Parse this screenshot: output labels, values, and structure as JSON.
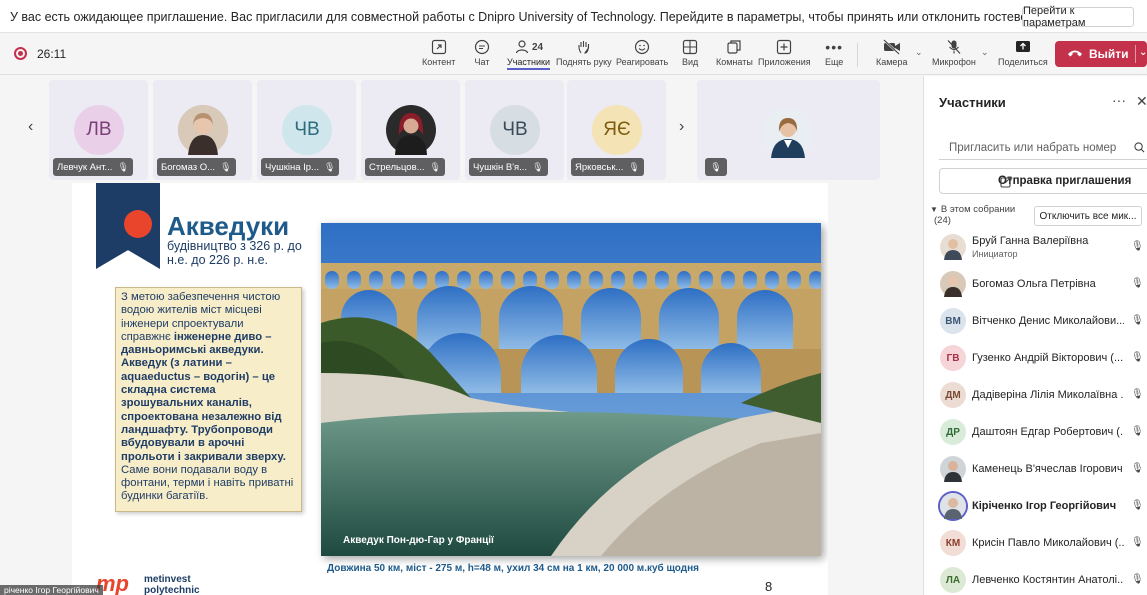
{
  "notification": {
    "text": "У вас есть ожидающее приглашение. Вас пригласили для совместной работы с Dnipro University of Technology. Перейдите в параметры, чтобы принять или отклонить гостевое приглашение.",
    "button": "Перейти к параметрам"
  },
  "toolbar": {
    "timer": "26:11",
    "items": [
      {
        "label": "Контент",
        "icon": "share-content-icon"
      },
      {
        "label": "Чат",
        "icon": "chat-icon"
      },
      {
        "label": "Участники",
        "icon": "people-icon",
        "count": "24"
      },
      {
        "label": "Поднять руку",
        "icon": "raise-hand-icon"
      },
      {
        "label": "Реагировать",
        "icon": "react-icon"
      },
      {
        "label": "Вид",
        "icon": "view-grid-icon"
      },
      {
        "label": "Комнаты",
        "icon": "breakout-rooms-icon"
      },
      {
        "label": "Приложения",
        "icon": "apps-icon"
      },
      {
        "label": "Еще",
        "icon": "more-icon"
      },
      {
        "label": "Камера",
        "icon": "camera-off-icon"
      },
      {
        "label": "Микрофон",
        "icon": "mic-off-icon"
      },
      {
        "label": "Поделиться",
        "icon": "share-icon"
      }
    ],
    "leave_label": "Выйти",
    "leave_color": "#c4314b"
  },
  "tiles": [
    {
      "initials": "ЛВ",
      "name": "Левчук Ант...",
      "bg": "#e9d0e8",
      "fg": "#7a3f78"
    },
    {
      "initials": "",
      "name": "Богомаз О...",
      "bg": "#c9b7a5",
      "photo": true
    },
    {
      "initials": "ЧВ",
      "name": "Чушкіна Ір...",
      "bg": "#cfe6ec",
      "fg": "#2e6b7d"
    },
    {
      "initials": "",
      "name": "Стрельцов...",
      "bg": "#6a2a2a",
      "photo": true
    },
    {
      "initials": "ЧВ",
      "name": "Чушкін В'я...",
      "bg": "#d6dde3",
      "fg": "#3b4b59"
    },
    {
      "initials": "ЯЄ",
      "name": "Ярковськ...",
      "bg": "#f3e3b5",
      "fg": "#7d5d10"
    }
  ],
  "slide": {
    "title": "Акведуки",
    "subtitle": "будівництво з 326 р. до н.е. до 226 р. н.е.",
    "body_normal_1": "З метою забезпечення чистою водою  жителів міст місцеві інженери спроектували справжнє",
    "body_bold": "інженерне диво – давньоримські акведуки. Акведук (з латини – aquaeductus – водогін) – це складна система зрошувальних каналів, спроектована незалежно від ландшафту. Трубопроводи вбудовували в арочні прольоти і закривали зверху.",
    "body_normal_2": "Саме вони подавали воду в фонтани, терми і навіть приватні будинки багатіїв.",
    "photo_caption": "Акведук Пон-дю-Гар у Франції",
    "footnote": "Довжина 50 км, міст - 275 м, h=48 м, ухил 34 см на 1 км, 20 000 м.куб щодня",
    "page": "8",
    "logo_mark": "mp",
    "logo_text_1": "metinvest",
    "logo_text_2": "polytechnic"
  },
  "self_label": "річенко Ігор Георгійович",
  "panel": {
    "title": "Участники",
    "search_placeholder": "Пригласить или набрать номер",
    "invite_label": "Отправка приглашения",
    "group_label": "В этом собрании",
    "group_count": "(24)",
    "mute_all_label": "Отключить все мик...",
    "participants": [
      {
        "initials": "",
        "name": "Бруй Ганна Валеріївна",
        "role": "Инициатор",
        "bg": "#b99a86",
        "photo": true
      },
      {
        "initials": "",
        "name": "Богомаз Ольга Петрівна",
        "role": "",
        "bg": "#c9b7a5",
        "photo": true
      },
      {
        "initials": "ВМ",
        "name": "Вітченко Денис Миколайови...",
        "role": "",
        "bg": "#dbe3ec",
        "fg": "#3a5675"
      },
      {
        "initials": "ГВ",
        "name": "Гузенко Андрій Вікторович (...",
        "role": "",
        "bg": "#f6d5d8",
        "fg": "#a3324a"
      },
      {
        "initials": "ДМ",
        "name": "Дадіверіна Лілія Миколаївна ...",
        "role": "",
        "bg": "#ecdcd4",
        "fg": "#7a4a35"
      },
      {
        "initials": "ДР",
        "name": "Даштоян Едгар Робертович (...",
        "role": "",
        "bg": "#d8ecd9",
        "fg": "#2f6b36"
      },
      {
        "initials": "",
        "name": "Каменець В'ячеслав Ігорович",
        "role": "",
        "bg": "#8a8f96",
        "photo": true
      },
      {
        "initials": "",
        "name": "Кіріченко Ігор Георгійович",
        "role": "",
        "bg": "#9aa3ad",
        "photo": true,
        "speaking": true
      },
      {
        "initials": "КМ",
        "name": "Крисін Павло Миколайович (...",
        "role": "",
        "bg": "#f2dcd6",
        "fg": "#8c3d2b"
      },
      {
        "initials": "ЛА",
        "name": "Левченко Костянтин Анатолі...",
        "role": "",
        "bg": "#dbe9d5",
        "fg": "#3d6b2f"
      }
    ]
  }
}
